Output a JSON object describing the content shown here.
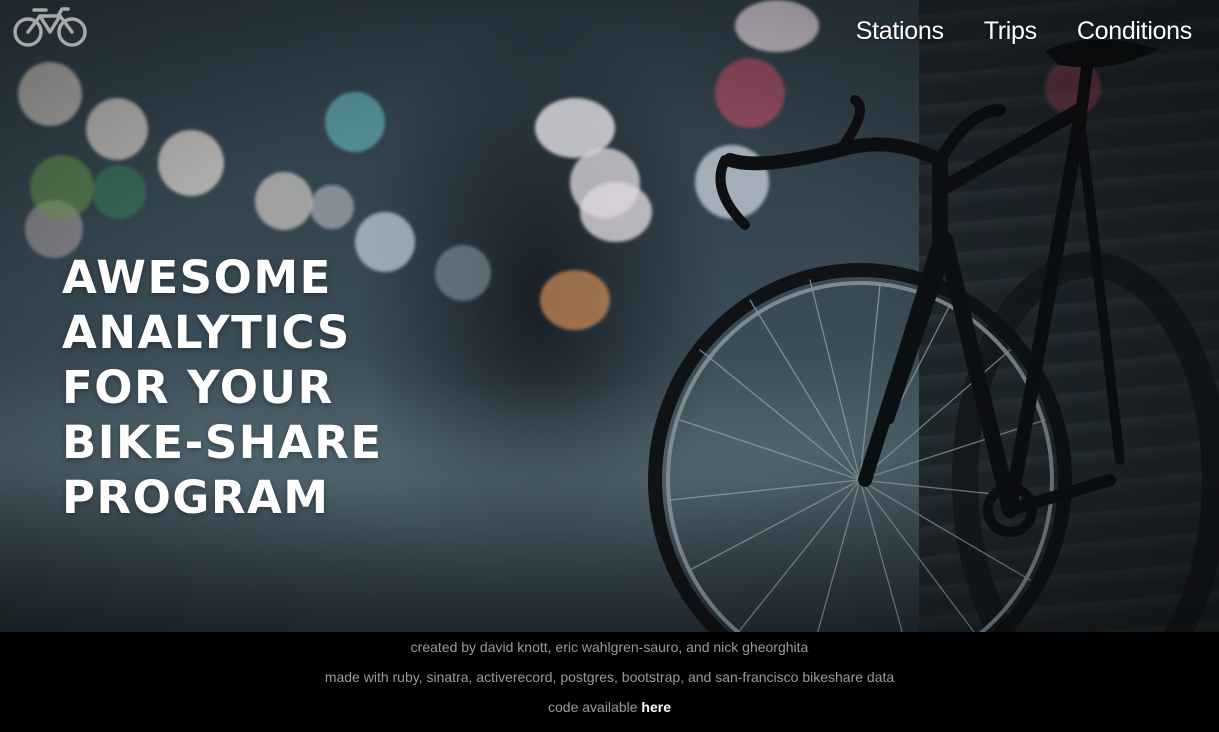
{
  "nav": {
    "logo_icon": "bicycle-icon",
    "items": [
      {
        "label": "Stations"
      },
      {
        "label": "Trips"
      },
      {
        "label": "Conditions"
      }
    ]
  },
  "hero": {
    "headline_lines": [
      "Awesome",
      "analytics",
      "for your",
      "bike-share",
      "program"
    ],
    "background": "blurred night street with bokeh lights and a road bicycle leaning on a wall"
  },
  "footer": {
    "credits": "created by david knott, eric wahlgren-sauro, and nick gheorghita",
    "made_with": "made with ruby, sinatra, activerecord, postgres, bootstrap, and san-francisco bikeshare data",
    "code_prefix": "code available",
    "code_link": "here"
  },
  "colors": {
    "nav_text": "#ffffff",
    "headline": "#ffffff",
    "footer_bg": "#000000",
    "footer_text": "#9a9a9a",
    "footer_link": "#ffffff"
  }
}
